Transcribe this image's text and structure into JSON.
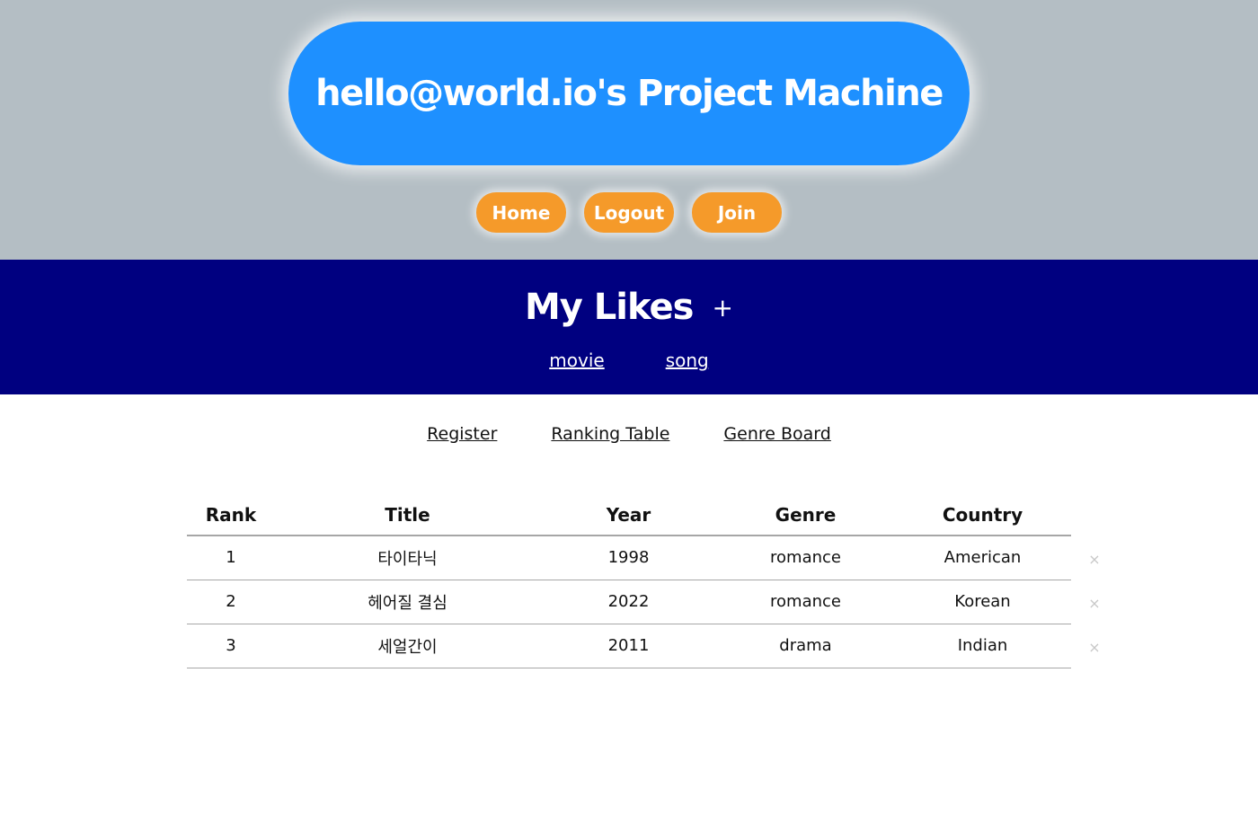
{
  "header": {
    "title": "hello@world.io's Project Machine",
    "nav": [
      "Home",
      "Logout",
      "Join"
    ]
  },
  "likes": {
    "title": "My Likes",
    "add_symbol": "+",
    "categories": [
      "movie",
      "song"
    ]
  },
  "sub_nav": [
    "Register",
    "Ranking Table",
    "Genre Board"
  ],
  "table": {
    "columns": [
      "Rank",
      "Title",
      "Year",
      "Genre",
      "Country"
    ],
    "rows": [
      [
        "1",
        "타이타닉",
        "1998",
        "romance",
        "American"
      ],
      [
        "2",
        "헤어질 결심",
        "2022",
        "romance",
        "Korean"
      ],
      [
        "3",
        "세얼간이",
        "2011",
        "drama",
        "Indian"
      ]
    ],
    "delete_symbol": "×"
  },
  "colors": {
    "top_bg": "#b4bec4",
    "title_pill": "#1e90ff",
    "nav_button": "#f59a2a",
    "likes_bg": "#000080"
  }
}
